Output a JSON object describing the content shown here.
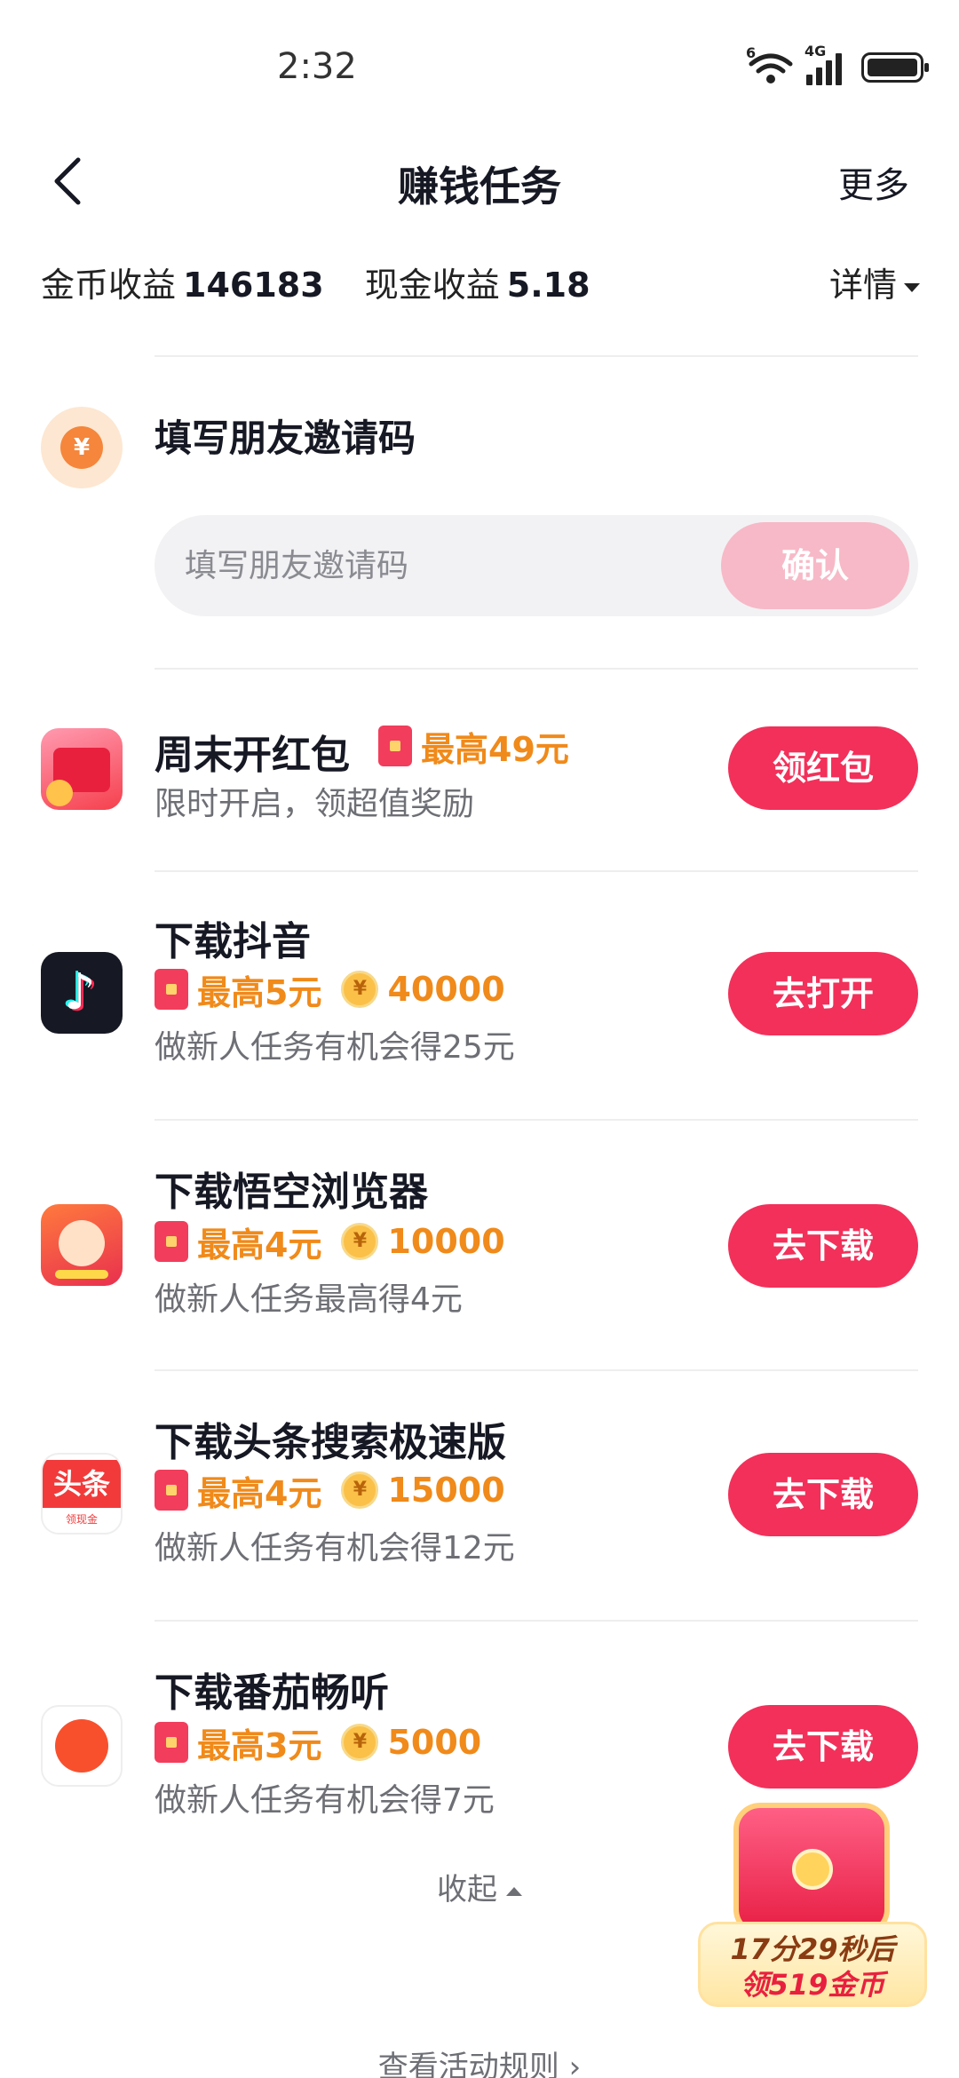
{
  "status_bar": {
    "time": "2:32",
    "wifi_badge": "6",
    "network": "4G"
  },
  "nav": {
    "title": "赚钱任务",
    "more": "更多"
  },
  "earnings": {
    "coin_label": "金币收益",
    "coin_value": "146183",
    "cash_label": "现金收益",
    "cash_value": "5.18",
    "detail": "详情"
  },
  "invite": {
    "icon_symbol": "¥",
    "title": "填写朋友邀请码",
    "placeholder": "填写朋友邀请码",
    "confirm": "确认"
  },
  "tasks": [
    {
      "title": "周末开红包",
      "redpack": "最高49元",
      "desc": "限时开启，领超值奖励",
      "action": "领红包"
    },
    {
      "title": "下载抖音",
      "redpack": "最高5元",
      "coins": "40000",
      "desc": "做新人任务有机会得25元",
      "action": "去打开"
    },
    {
      "title": "下载悟空浏览器",
      "redpack": "最高4元",
      "coins": "10000",
      "desc": "做新人任务最高得4元",
      "action": "去下载"
    },
    {
      "title": "下载头条搜索极速版",
      "redpack": "最高4元",
      "coins": "15000",
      "desc": "做新人任务有机会得12元",
      "action": "去下载",
      "icon_text": "头条",
      "icon_sub": "领现金"
    },
    {
      "title": "下载番茄畅听",
      "redpack": "最高3元",
      "coins": "5000",
      "desc": "做新人任务有机会得7元",
      "action": "去下载"
    }
  ],
  "coin_symbol": "¥",
  "collapse": "收起",
  "rules": "查看活动规则 ›",
  "chest": {
    "line1": "17分29秒后",
    "line2": "领519金币"
  },
  "colors": {
    "primary": "#f2305a",
    "confirm_disabled": "#f7b9c7",
    "reward": "#f08a1a",
    "text": "#161823",
    "secondary_text": "#6e6f75"
  },
  "icons": [
    "back-chevron-icon",
    "wifi-icon",
    "signal-icon",
    "battery-icon",
    "caret-down-icon",
    "caret-up-icon",
    "redpack-icon",
    "coin-icon"
  ]
}
